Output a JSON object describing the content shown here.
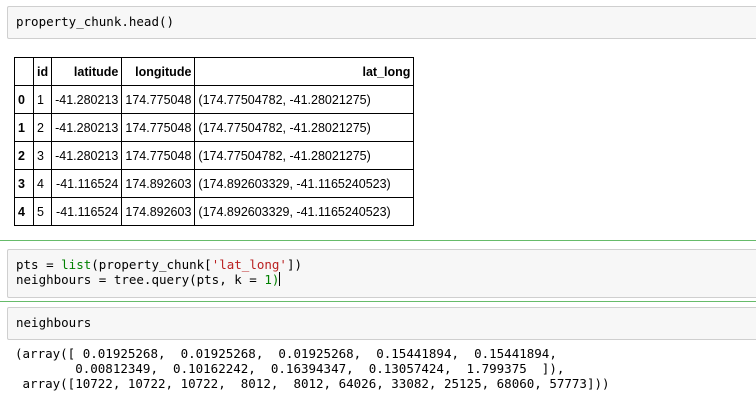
{
  "cells": {
    "head_input": "property_chunk.head()",
    "query_line1": {
      "pre": "pts = ",
      "fn": "list",
      "mid": "(property_chunk[",
      "str": "'lat_long'",
      "post": "])"
    },
    "query_line2": {
      "pre": "neighbours = tree.query(pts, k = ",
      "num": "1",
      "post": ")"
    },
    "neighbours_input": "neighbours",
    "neighbours_output": "(array([ 0.01925268,  0.01925268,  0.01925268,  0.15441894,  0.15441894,\n        0.00812349,  0.10162242,  0.16394347,  0.13057424,  1.799375  ]),\n array([10722, 10722, 10722,  8012,  8012, 64026, 33082, 25125, 68060, 57773]))"
  },
  "table": {
    "columns": [
      "",
      "id",
      "latitude",
      "longitude",
      "lat_long"
    ],
    "rows": [
      {
        "index": "0",
        "id": "1",
        "latitude": "-41.280213",
        "longitude": "174.775048",
        "lat_long": "(174.77504782, -41.28021275)"
      },
      {
        "index": "1",
        "id": "2",
        "latitude": "-41.280213",
        "longitude": "174.775048",
        "lat_long": "(174.77504782, -41.28021275)"
      },
      {
        "index": "2",
        "id": "3",
        "latitude": "-41.280213",
        "longitude": "174.775048",
        "lat_long": "(174.77504782, -41.28021275)"
      },
      {
        "index": "3",
        "id": "4",
        "latitude": "-41.116524",
        "longitude": "174.892603",
        "lat_long": "(174.892603329, -41.1165240523)"
      },
      {
        "index": "4",
        "id": "5",
        "latitude": "-41.116524",
        "longitude": "174.892603",
        "lat_long": "(174.892603329, -41.1165240523)"
      }
    ]
  },
  "colors": {
    "cell_bg": "#f7f7f7",
    "cell_border": "#cfcfcf",
    "separator": "#66bb6a",
    "keyword": "#008000",
    "string": "#ba2121"
  }
}
